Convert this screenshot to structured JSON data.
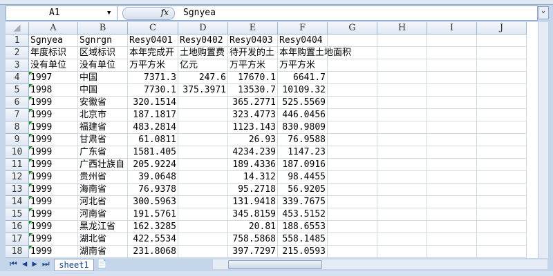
{
  "name_box": "A1",
  "formula_icon": "fx",
  "formula_value": "Sgnyea",
  "columns": [
    "A",
    "B",
    "C",
    "D",
    "E",
    "F",
    "G",
    "H",
    "I",
    "J"
  ],
  "rows": [
    [
      "1",
      [
        "Sgnyea",
        "Sgnrgn",
        "Resy0401",
        "Resy0402",
        "Resy0403",
        "Resy0404"
      ]
    ],
    [
      "2",
      [
        "年度标识",
        "区域标识",
        "本年完成开",
        "土地购置费",
        "待开发的土",
        "本年购置土地面积"
      ]
    ],
    [
      "3",
      [
        "没有单位",
        "没有单位",
        "万平方米",
        "亿元",
        "万平方米",
        "万平方米"
      ]
    ],
    [
      "4",
      [
        "1997",
        "中国",
        "7371.3",
        "247.6",
        "17670.1",
        "6641.7"
      ]
    ],
    [
      "5",
      [
        "1998",
        "中国",
        "7730.1",
        "375.3971",
        "13530.7",
        "10109.32"
      ]
    ],
    [
      "6",
      [
        "1999",
        "安徽省",
        "320.1514",
        "",
        "365.2771",
        "525.5569"
      ]
    ],
    [
      "7",
      [
        "1999",
        "北京市",
        "187.1817",
        "",
        "323.4773",
        "446.0456"
      ]
    ],
    [
      "8",
      [
        "1999",
        "福建省",
        "483.2814",
        "",
        "1123.143",
        "830.9809"
      ]
    ],
    [
      "9",
      [
        "1999",
        "甘肃省",
        "61.0811",
        "",
        "26.93",
        "76.9588"
      ]
    ],
    [
      "10",
      [
        "1999",
        "广东省",
        "1581.405",
        "",
        "4234.239",
        "1147.23"
      ]
    ],
    [
      "11",
      [
        "1999",
        "广西壮族自",
        "205.9224",
        "",
        "189.4336",
        "187.0916"
      ]
    ],
    [
      "12",
      [
        "1999",
        "贵州省",
        "39.0648",
        "",
        "14.312",
        "98.4455"
      ]
    ],
    [
      "13",
      [
        "1999",
        "海南省",
        "76.9378",
        "",
        "95.2718",
        "56.9205"
      ]
    ],
    [
      "14",
      [
        "1999",
        "河北省",
        "300.5963",
        "",
        "131.9418",
        "339.7675"
      ]
    ],
    [
      "15",
      [
        "1999",
        "河南省",
        "191.5761",
        "",
        "345.8159",
        "453.5152"
      ]
    ],
    [
      "16",
      [
        "1999",
        "黑龙江省",
        "162.3285",
        "",
        "20.81",
        "188.6553"
      ]
    ],
    [
      "17",
      [
        "1999",
        "湖北省",
        "422.5534",
        "",
        "758.5868",
        "558.1485"
      ]
    ],
    [
      "18",
      [
        "1999",
        "湖南省",
        "231.8068",
        "",
        "397.7297",
        "215.0593"
      ]
    ]
  ],
  "sheet_tab": "sheet1"
}
